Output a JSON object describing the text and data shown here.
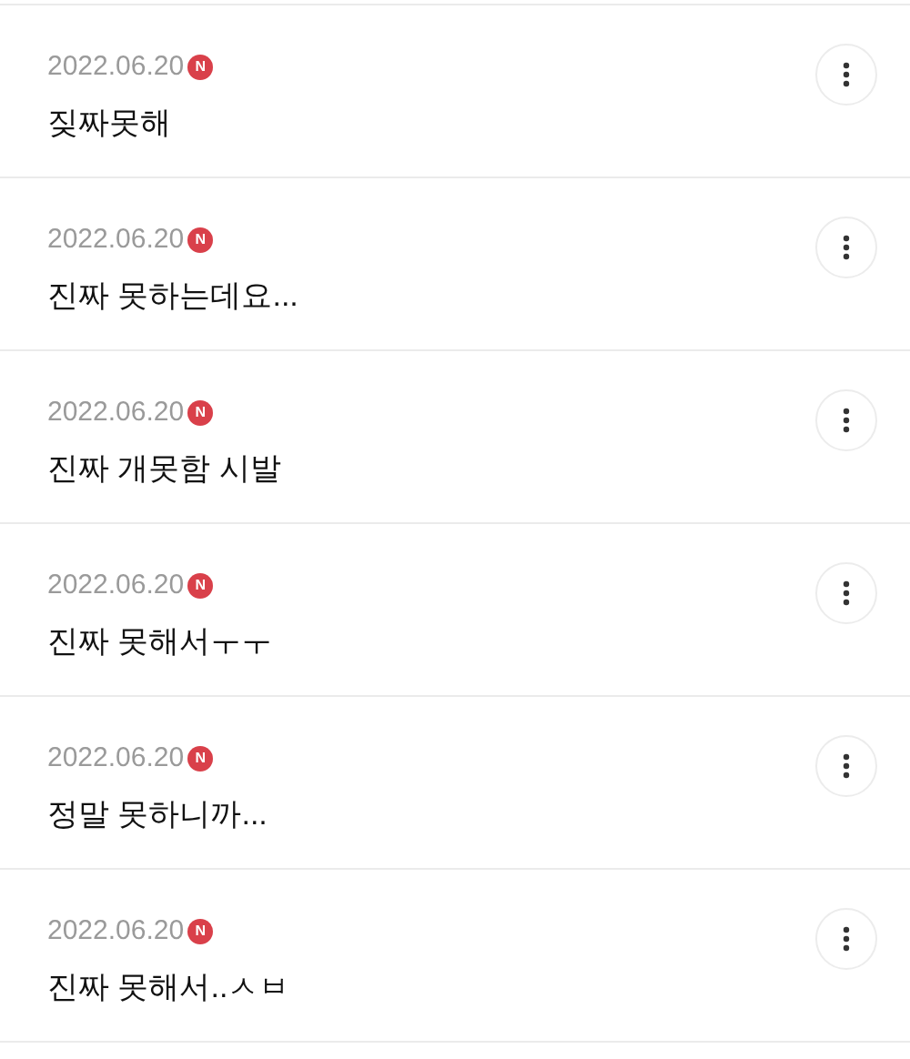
{
  "comments": [
    {
      "date": "2022.06.20",
      "badge": "N",
      "text": "짖짜못해"
    },
    {
      "date": "2022.06.20",
      "badge": "N",
      "text": "진짜 못하는데요..."
    },
    {
      "date": "2022.06.20",
      "badge": "N",
      "text": "진짜 개못함 시발"
    },
    {
      "date": "2022.06.20",
      "badge": "N",
      "text": "진짜 못해서ㅜㅜ"
    },
    {
      "date": "2022.06.20",
      "badge": "N",
      "text": "정말 못하니까..."
    },
    {
      "date": "2022.06.20",
      "badge": "N",
      "text": "진짜 못해서..ㅅㅂ"
    }
  ]
}
